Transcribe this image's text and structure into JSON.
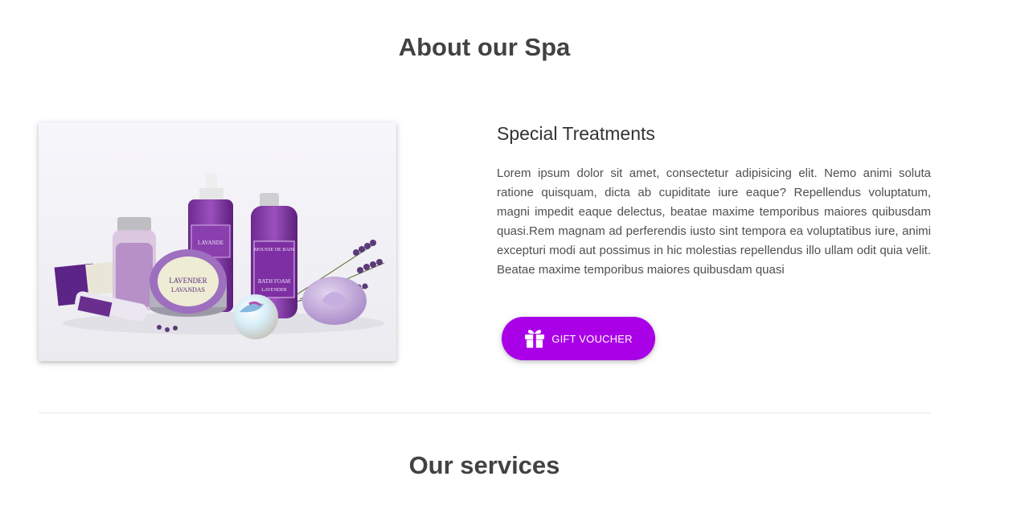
{
  "about": {
    "title": "About our Spa",
    "image_alt": "Lavender spa products: bath salts, liquid soap, bath foam, lavender balm, bath bomb and soap bars",
    "product_labels": {
      "balm": "LAVENDER",
      "balm_sub": "LAVANDAS",
      "soap_bottle": "LAVANDE",
      "foam_bottle_top": "MOUSSE DE BAIN",
      "foam_bottle": "BATH FOAM",
      "foam_bottle_sub": "LAVENDER"
    },
    "heading": "Special Treatments",
    "body": "Lorem ipsum dolor sit amet, consectetur adipisicing elit. Nemo animi soluta ratione quisquam, dicta ab cupiditate iure eaque? Repellendus voluptatum, magni impedit eaque delectus, beatae maxime temporibus maiores quibusdam quasi.Rem magnam ad perferendis iusto sint tempora ea voluptatibus iure, animi excepturi modi aut possimus in hic molestias repellendus illo ullam odit quia velit. Beatae maxime temporibus maiores quibusdam quasi",
    "button_label": "GIFT VOUCHER",
    "button_icon": "gift-icon"
  },
  "services": {
    "title": "Our services"
  },
  "colors": {
    "accent": "#aa00e8",
    "heading": "#424242",
    "text": "#4f4f4f",
    "divider": "#e6e6e6"
  }
}
